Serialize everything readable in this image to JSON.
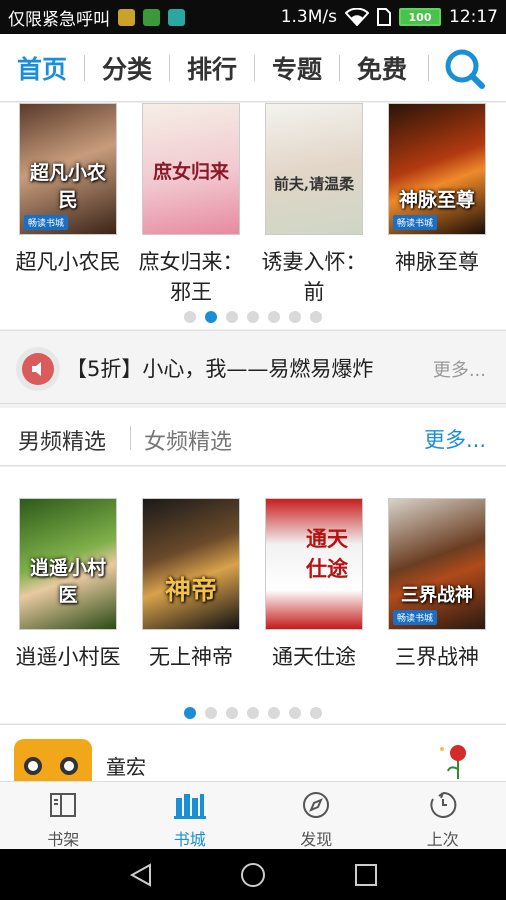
{
  "status_bar": {
    "carrier": "仅限紧急呼叫",
    "speed": "1.3M/s",
    "battery": "100",
    "time": "12:17"
  },
  "top_nav": {
    "tabs": [
      "首页",
      "分类",
      "排行",
      "专题",
      "免费"
    ],
    "active_tab": "首页",
    "icons": [
      "search-icon"
    ]
  },
  "featured_books": [
    {
      "name": "超凡小农民",
      "cover_text": "超凡小农民"
    },
    {
      "name": "庶女归来：邪王",
      "cover_text": "庶女归来"
    },
    {
      "name": "诱妻入怀：前",
      "cover_text": "前夫,请温柔"
    },
    {
      "name": "神脉至尊",
      "cover_text": "神脉至尊"
    }
  ],
  "cover_brand": "畅读书城",
  "featured_page": {
    "total": 7,
    "current": 2
  },
  "notice": {
    "text": "【5折】小心，我——易燃易爆炸",
    "more": "更多..."
  },
  "channel": {
    "tabs": [
      "男频精选",
      "女频精选"
    ],
    "active_tab": "男频精选",
    "more": "更多..."
  },
  "channel_books": [
    {
      "name": "逍遥小村医",
      "cover_text": "逍遥小村医"
    },
    {
      "name": "无上神帝",
      "cover_text": "神帝"
    },
    {
      "name": "通天仕途",
      "cover_text": "通天仕途"
    },
    {
      "name": "三界战神",
      "cover_text": "三界战神"
    }
  ],
  "channel_page": {
    "total": 7,
    "current": 1
  },
  "author": {
    "name": "童宏"
  },
  "bottom_nav": {
    "items": [
      "书架",
      "书城",
      "发现",
      "上次"
    ],
    "active": "书城",
    "icons": [
      "bookshelf-icon",
      "bookstore-icon",
      "compass-icon",
      "history-icon"
    ]
  },
  "colors": {
    "accent": "#1a8fd6",
    "status_bar": "#0c0c0c",
    "notice_icon": "#e56060"
  }
}
